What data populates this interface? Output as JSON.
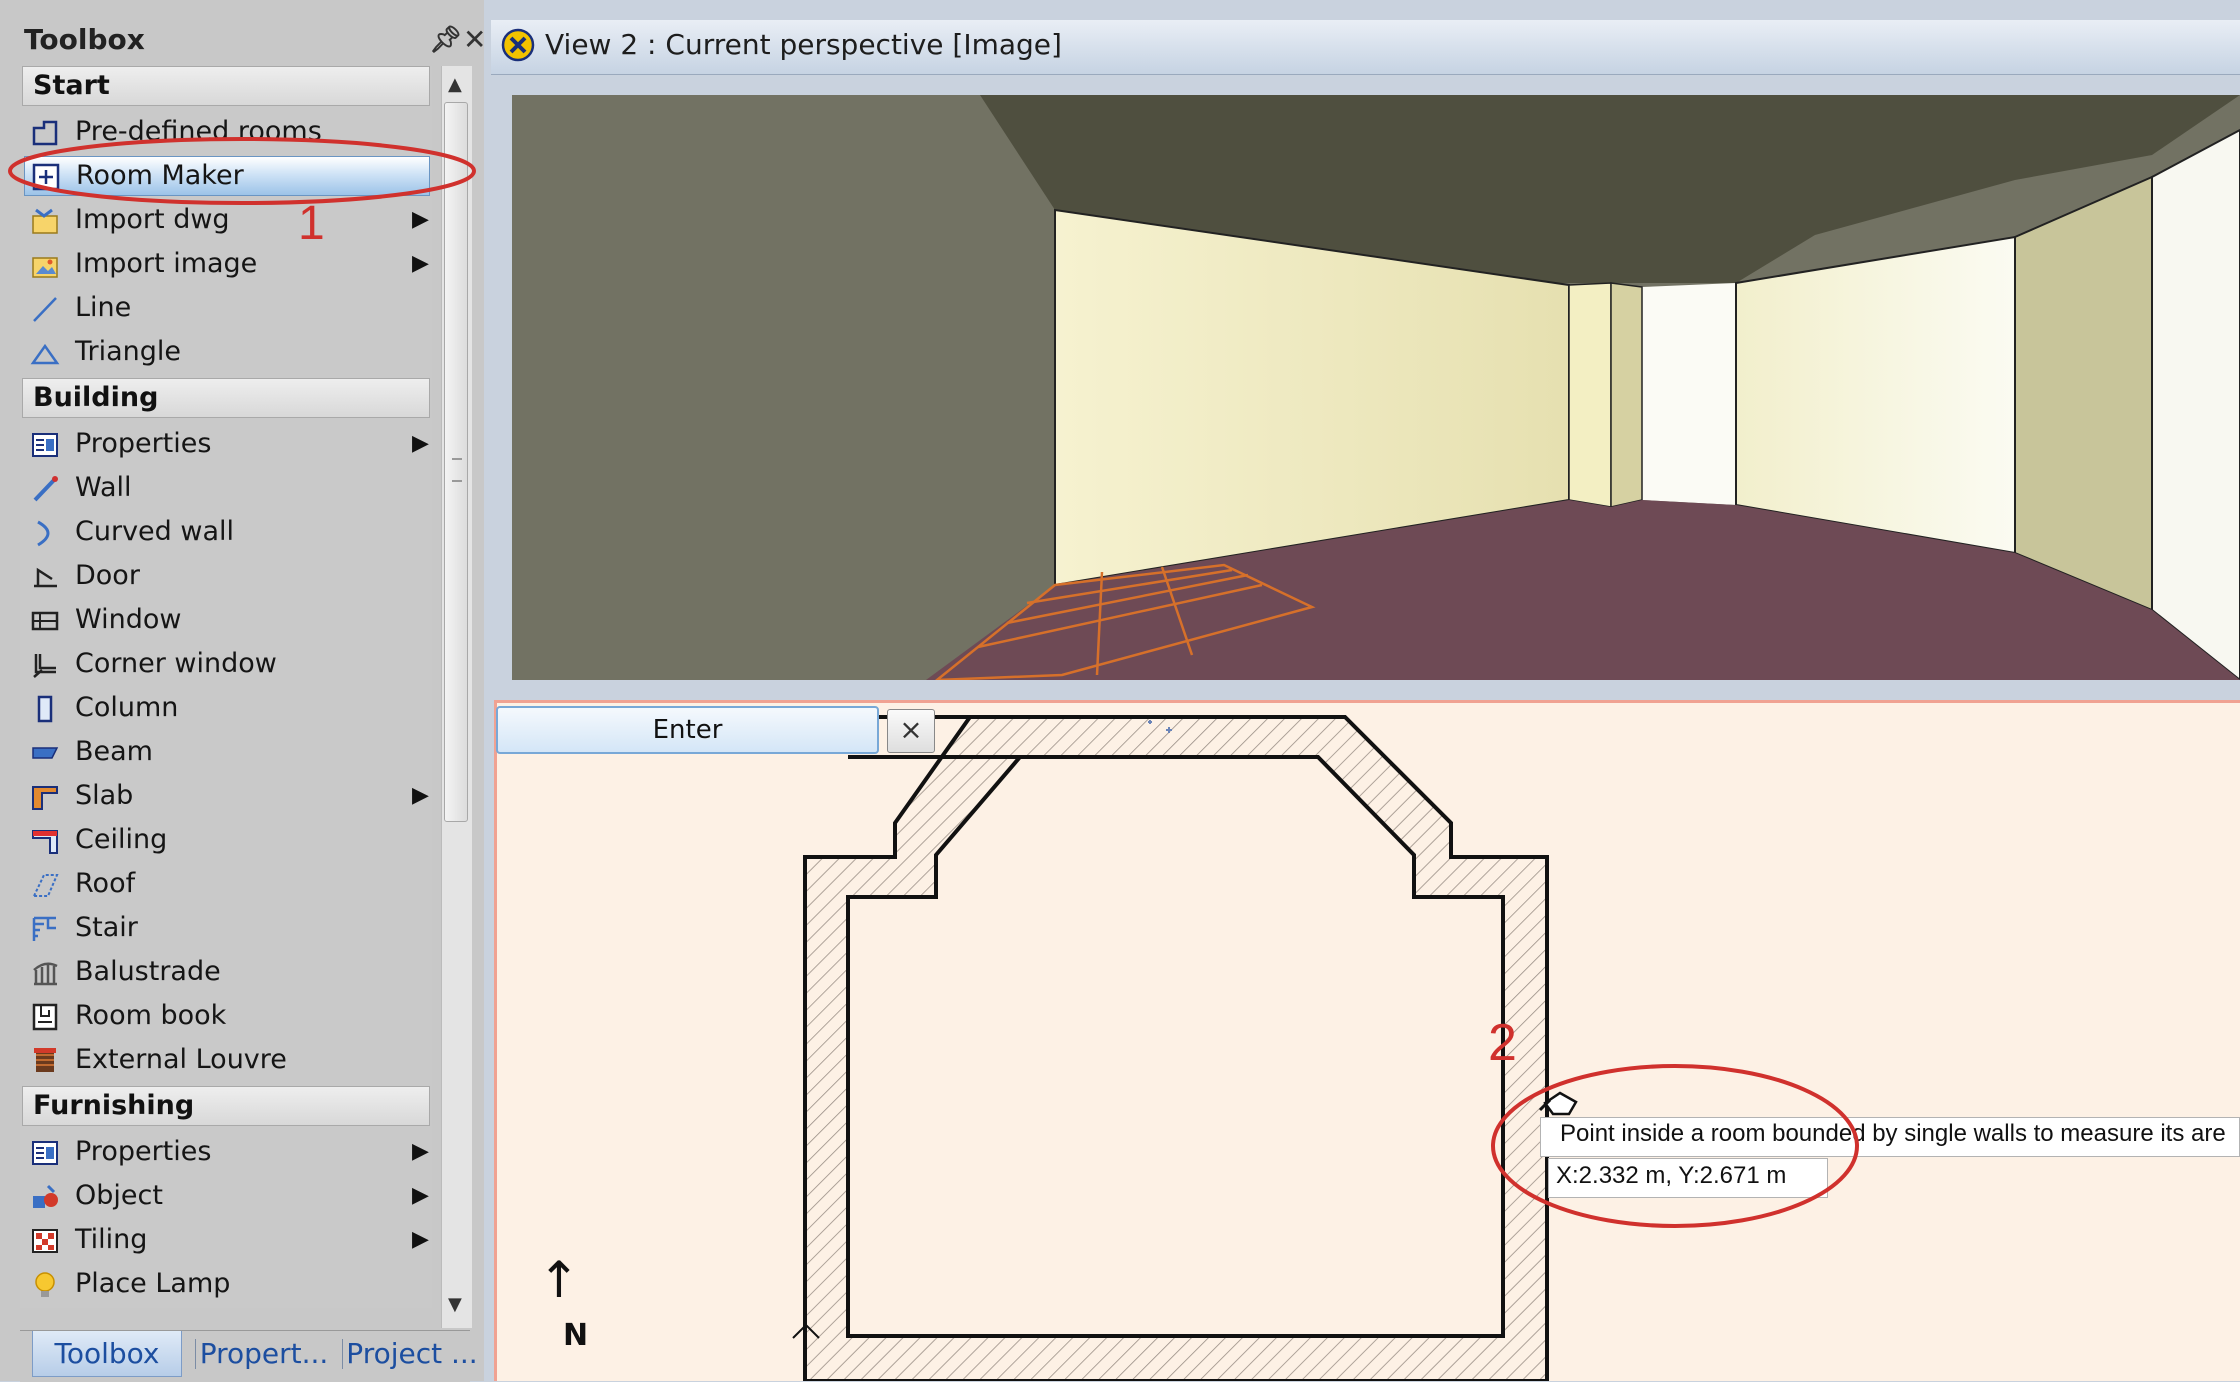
{
  "toolbox": {
    "title": "Toolbox",
    "pin_icon": "pin-icon",
    "close_icon": "close-icon",
    "categories": [
      {
        "label": "Start",
        "items": [
          {
            "label": "Pre-defined rooms",
            "icon": "predefined-rooms-icon",
            "submenu": false
          },
          {
            "label": "Room Maker",
            "icon": "room-maker-icon",
            "submenu": false,
            "selected": true
          },
          {
            "label": "Import dwg",
            "icon": "import-dwg-icon",
            "submenu": true
          },
          {
            "label": "Import image",
            "icon": "import-image-icon",
            "submenu": true
          },
          {
            "label": "Line",
            "icon": "line-icon",
            "submenu": false
          },
          {
            "label": "Triangle",
            "icon": "triangle-icon",
            "submenu": false
          }
        ]
      },
      {
        "label": "Building",
        "items": [
          {
            "label": "Properties",
            "icon": "properties-icon",
            "submenu": true
          },
          {
            "label": "Wall",
            "icon": "wall-icon",
            "submenu": false
          },
          {
            "label": "Curved wall",
            "icon": "curved-wall-icon",
            "submenu": false
          },
          {
            "label": "Door",
            "icon": "door-icon",
            "submenu": false
          },
          {
            "label": "Window",
            "icon": "window-icon",
            "submenu": false
          },
          {
            "label": "Corner window",
            "icon": "corner-window-icon",
            "submenu": false
          },
          {
            "label": "Column",
            "icon": "column-icon",
            "submenu": false
          },
          {
            "label": "Beam",
            "icon": "beam-icon",
            "submenu": false
          },
          {
            "label": "Slab",
            "icon": "slab-icon",
            "submenu": true
          },
          {
            "label": "Ceiling",
            "icon": "ceiling-icon",
            "submenu": false
          },
          {
            "label": "Roof",
            "icon": "roof-icon",
            "submenu": false
          },
          {
            "label": "Stair",
            "icon": "stair-icon",
            "submenu": false
          },
          {
            "label": "Balustrade",
            "icon": "balustrade-icon",
            "submenu": false
          },
          {
            "label": "Room book",
            "icon": "room-book-icon",
            "submenu": false
          },
          {
            "label": "External Louvre",
            "icon": "external-louvre-icon",
            "submenu": false
          }
        ]
      },
      {
        "label": "Furnishing",
        "items": [
          {
            "label": "Properties",
            "icon": "properties-icon",
            "submenu": true
          },
          {
            "label": "Object",
            "icon": "object-icon",
            "submenu": true
          },
          {
            "label": "Tiling",
            "icon": "tiling-icon",
            "submenu": true
          },
          {
            "label": "Place Lamp",
            "icon": "lamp-icon",
            "submenu": false
          }
        ]
      }
    ],
    "tabs": [
      "Toolbox",
      "Propert...",
      "Project ..."
    ],
    "active_tab": 0
  },
  "view": {
    "title": "View 2 : Current perspective [Image]",
    "icon": "view-close-icon"
  },
  "plan": {
    "enter_label": "Enter",
    "enter_close": "×",
    "north_label": "N",
    "tooltip": "Point inside a room bounded by single walls to measure its are",
    "coordinates": "X:2.332 m, Y:2.671 m"
  },
  "annotations": {
    "step1": "1",
    "step2": "2",
    "color": "#d0312d"
  },
  "colors": {
    "floor": "#6e4a55",
    "ceiling": "#4f4f3f",
    "wall_light": "#f4f0c8",
    "selection": "#9cc3e8",
    "plan_bg": "#fdf1e5"
  }
}
